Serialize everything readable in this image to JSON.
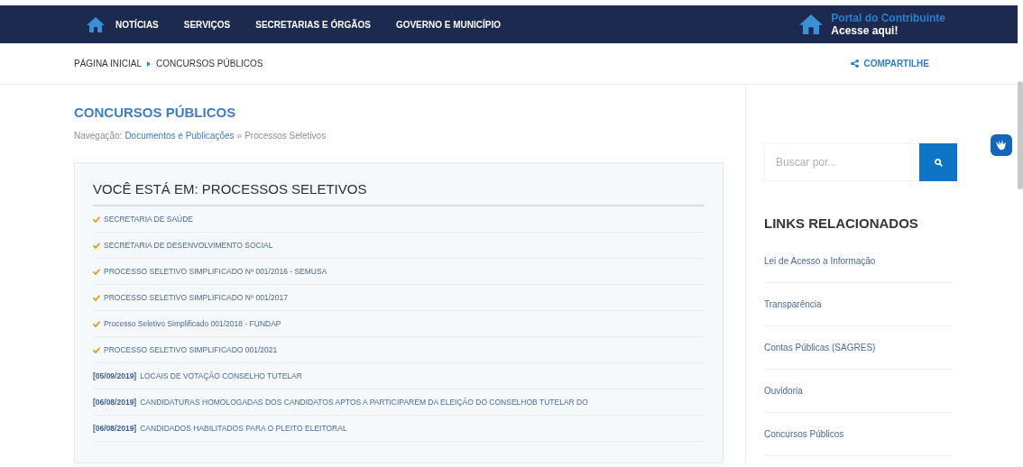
{
  "nav": {
    "items": [
      "NOTÍCIAS",
      "SERVIÇOS",
      "SECRETARIAS E ÓRGÃOS",
      "GOVERNO E MUNICÍPIO"
    ],
    "portal_title": "Portal do Contribuinte",
    "portal_link": "Acesse aqui!"
  },
  "breadcrumb": {
    "items": [
      "PÁGINA INICIAL",
      "CONCURSOS PÚBLICOS"
    ],
    "share": "COMPARTILHE"
  },
  "page_title": "CONCURSOS PÚBLICOS",
  "navigation": {
    "label": "Navegação:",
    "link": "Documentos e Publicações",
    "separator": "»",
    "current": "Processos Seletivos"
  },
  "panel": {
    "title": "VOCÊ ESTÁ EM: PROCESSOS SELETIVOS",
    "items": [
      {
        "kind": "check",
        "text": "SECRETARIA DE SAÚDE"
      },
      {
        "kind": "check",
        "text": "SECRETARIA DE DESENVOLVIMENTO SOCIAL"
      },
      {
        "kind": "check",
        "text": "PROCESSO SELETIVO SIMPLIFICADO Nº 001/2016 - SEMUSA"
      },
      {
        "kind": "check",
        "text": "PROCESSO SELETIVO SIMPLIFICADO Nº 001/2017"
      },
      {
        "kind": "check",
        "text": "Processo Seletivo Simplificado 001/2018 - FUNDAP"
      },
      {
        "kind": "check",
        "text": "PROCESSO SELETIVO SIMPLIFICADO 001/2021"
      },
      {
        "kind": "dated",
        "date": "[05/09/2019]",
        "text": "LOCAIS DE VOTAÇÃO CONSELHO TUTELAR"
      },
      {
        "kind": "dated",
        "date": "[06/08/2019]",
        "text": "CANDIDATURAS HOMOLOGADAS DOS CANDIDATOS APTOS A PARTICIPAREM DA ELEIÇÃO DO CONSELHOB TUTELAR DO"
      },
      {
        "kind": "dated",
        "date": "[06/08/2019]",
        "text": "CANDIDADOS HABILITADOS PARA O PLEITO ELEITORAL"
      }
    ]
  },
  "search": {
    "placeholder": "Buscar por..."
  },
  "related": {
    "title": "LINKS RELACIONADOS",
    "links": [
      "Lei de Acesso a Informação",
      "Transparência",
      "Contas Públicas (SAGRES)",
      "Ouvidoria",
      "Concursos Públicos"
    ]
  }
}
